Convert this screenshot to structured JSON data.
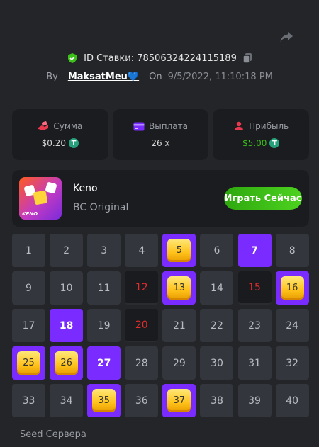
{
  "header": {
    "bet_id_label": "ID Ставки:",
    "bet_id": "78506324224115189",
    "by_label": "By",
    "username": "MaksatMeu💙",
    "on_label": "On",
    "date": "9/5/2022, 11:10:18 PM"
  },
  "stats": [
    {
      "label": "Сумма",
      "value": "$0.20",
      "coin": "T",
      "icon": "money-hand-icon"
    },
    {
      "label": "Выплата",
      "value": "26 x",
      "icon": "card-icon"
    },
    {
      "label": "Прибыль",
      "value": "$5.00",
      "coin": "T",
      "icon": "profit-user-icon"
    }
  ],
  "game": {
    "name": "Keno",
    "provider": "BC Original",
    "thumb_label": "KENO",
    "play_label": "Играть Сейчас"
  },
  "grid": {
    "numbers": [
      1,
      2,
      3,
      4,
      5,
      6,
      7,
      8,
      9,
      10,
      11,
      12,
      13,
      14,
      15,
      16,
      17,
      18,
      19,
      20,
      21,
      22,
      23,
      24,
      25,
      26,
      27,
      28,
      29,
      30,
      31,
      32,
      33,
      34,
      35,
      36,
      37,
      38,
      39,
      40
    ],
    "selected_hits": [
      5,
      13,
      16,
      25,
      26,
      35,
      37
    ],
    "selected_misses": [
      7,
      18,
      27
    ],
    "drawn_misses": [
      12,
      15,
      20
    ]
  },
  "footer": {
    "seed_label": "Seed Сервера"
  },
  "colors": {
    "accent": "#7a2bff",
    "green": "#3bc117",
    "red": "#e02d2d",
    "gem": "#ffc21a"
  }
}
